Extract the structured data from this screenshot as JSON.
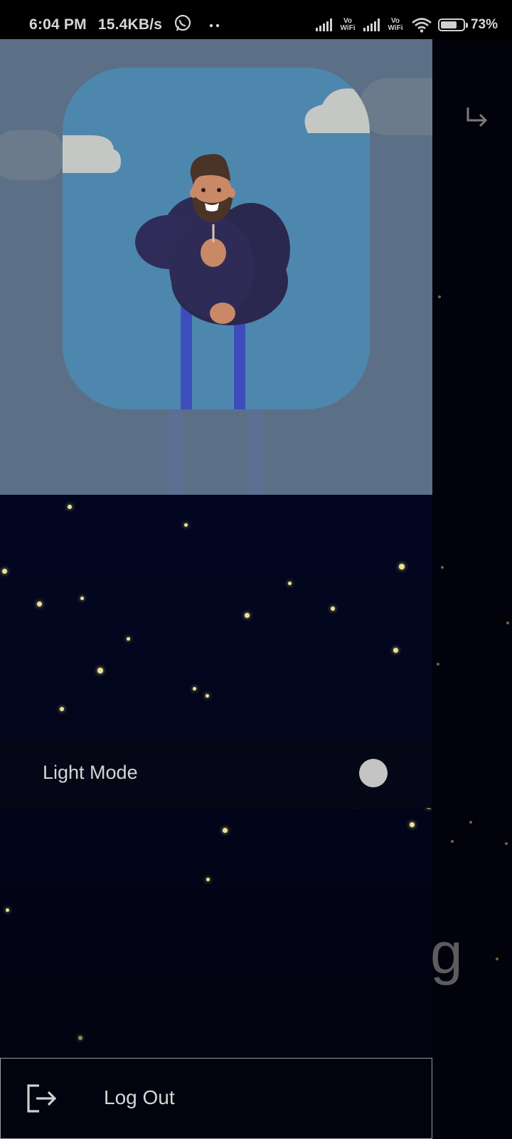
{
  "status_bar": {
    "time": "6:04 PM",
    "speed": "15.4KB/s",
    "notification_icons": [
      "whatsapp-icon",
      "dots-icon"
    ],
    "vowifi_1": "Vo WiFi",
    "vowifi_2": "Vo WiFi",
    "battery": "73%",
    "battery_level": 0.73
  },
  "background_app": {
    "back_icon": "back-arrow-icon",
    "partial_text": "g"
  },
  "drawer": {
    "header": {
      "illustration": "bearded-man-illustration"
    },
    "theme_toggle": {
      "label": "Light Mode",
      "state": "off"
    },
    "logout": {
      "icon": "logout-icon",
      "label": "Log Out"
    }
  },
  "colors": {
    "header_bg": "#5b7087",
    "avatar_card_bg": "#4e87ae",
    "drawer_bg": "#030728",
    "toggle_knob": "#c4c4c4",
    "text": "#d4d4d4"
  }
}
